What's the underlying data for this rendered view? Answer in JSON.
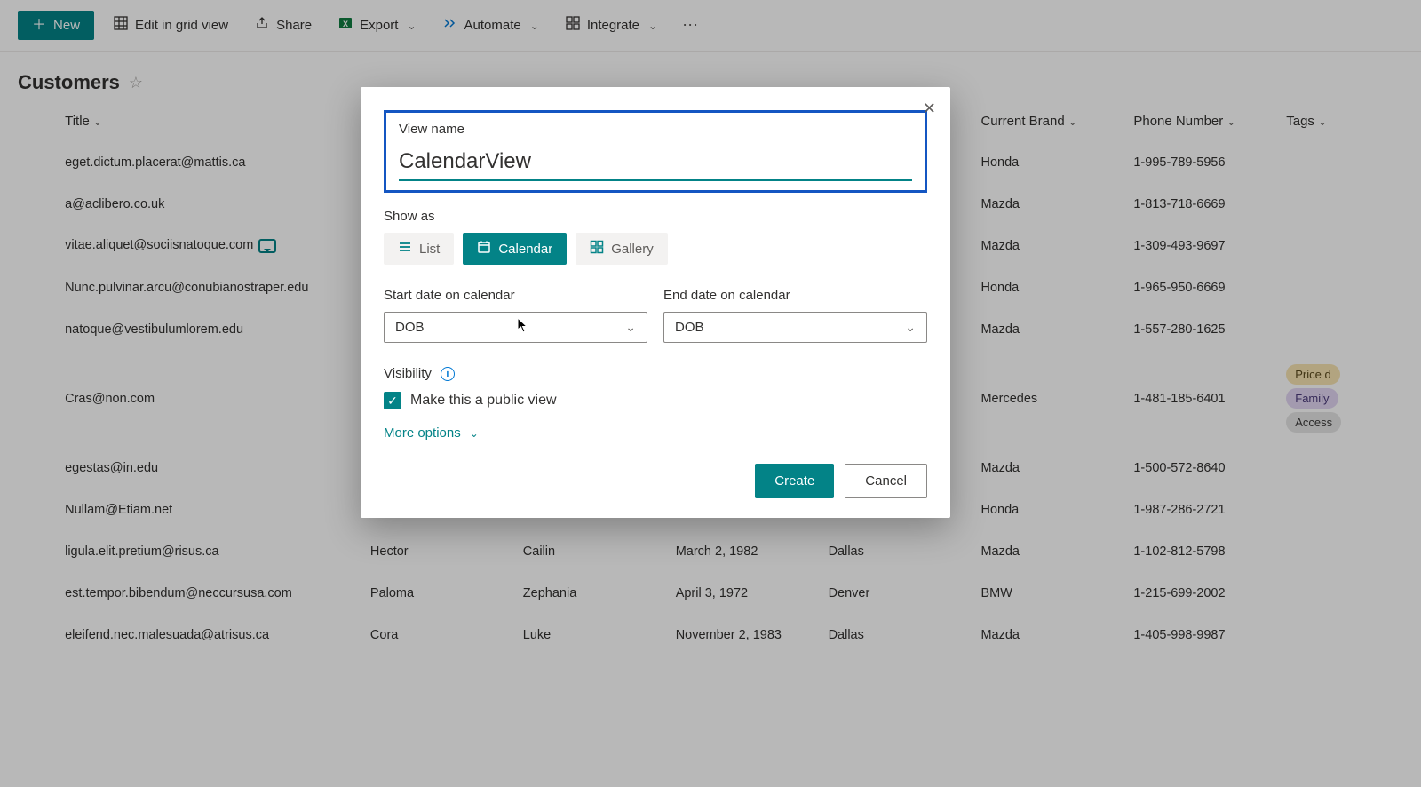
{
  "colors": {
    "accent": "#038387",
    "focus": "#1456C2"
  },
  "toolbar": {
    "new_label": "New",
    "edit_grid_label": "Edit in grid view",
    "share_label": "Share",
    "export_label": "Export",
    "automate_label": "Automate",
    "integrate_label": "Integrate"
  },
  "header": {
    "title": "Customers"
  },
  "columns": {
    "title": "Title",
    "current_brand": "Current Brand",
    "phone": "Phone Number",
    "tags": "Tags"
  },
  "rows": [
    {
      "title": "eget.dictum.placerat@mattis.ca",
      "brand": "Honda",
      "phone": "1-995-789-5956"
    },
    {
      "title": "a@aclibero.co.uk",
      "brand": "Mazda",
      "phone": "1-813-718-6669"
    },
    {
      "title": "vitae.aliquet@sociisnatoque.com",
      "brand": "Mazda",
      "phone": "1-309-493-9697",
      "has_comment": true
    },
    {
      "title": "Nunc.pulvinar.arcu@conubianostraper.edu",
      "brand": "Honda",
      "phone": "1-965-950-6669"
    },
    {
      "title": "natoque@vestibulumlorem.edu",
      "brand": "Mazda",
      "phone": "1-557-280-1625"
    },
    {
      "title": "Cras@non.com",
      "brand": "Mercedes",
      "phone": "1-481-185-6401",
      "tags": [
        "Price d",
        "Family",
        "Access"
      ]
    },
    {
      "title": "egestas@in.edu",
      "brand": "Mazda",
      "phone": "1-500-572-8640"
    },
    {
      "title": "Nullam@Etiam.net",
      "brand": "Honda",
      "phone": "1-987-286-2721"
    },
    {
      "title": "ligula.elit.pretium@risus.ca",
      "fn": "Hector",
      "ln": "Cailin",
      "dob": "March 2, 1982",
      "city": "Dallas",
      "brand": "Mazda",
      "phone": "1-102-812-5798"
    },
    {
      "title": "est.tempor.bibendum@neccursusa.com",
      "fn": "Paloma",
      "ln": "Zephania",
      "dob": "April 3, 1972",
      "city": "Denver",
      "brand": "BMW",
      "phone": "1-215-699-2002"
    },
    {
      "title": "eleifend.nec.malesuada@atrisus.ca",
      "fn": "Cora",
      "ln": "Luke",
      "dob": "November 2, 1983",
      "city": "Dallas",
      "brand": "Mazda",
      "phone": "1-405-998-9987"
    }
  ],
  "modal": {
    "view_name_label": "View name",
    "view_name_value": "CalendarView",
    "show_as_label": "Show as",
    "show_as": {
      "list": "List",
      "calendar": "Calendar",
      "gallery": "Gallery",
      "selected": "calendar"
    },
    "start_date_label": "Start date on calendar",
    "end_date_label": "End date on calendar",
    "start_date_value": "DOB",
    "end_date_value": "DOB",
    "visibility_label": "Visibility",
    "public_view_label": "Make this a public view",
    "public_view_checked": true,
    "more_options_label": "More options",
    "create_label": "Create",
    "cancel_label": "Cancel"
  }
}
